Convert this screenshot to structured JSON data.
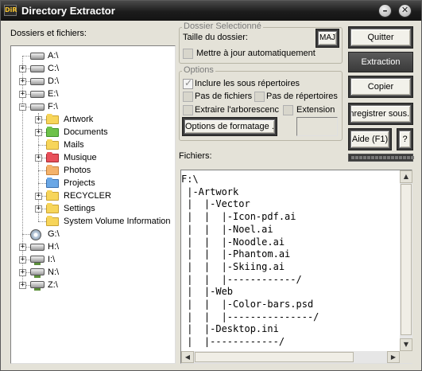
{
  "window": {
    "title": "Directory Extractor",
    "icon_text": "DiR"
  },
  "tree": {
    "label": "Dossiers et fichiers:",
    "items": [
      {
        "label": "A:\\",
        "icon": "floppy-drive-icon",
        "expander": "",
        "level": 0
      },
      {
        "label": "C:\\",
        "icon": "hard-drive-icon",
        "expander": "+",
        "level": 0
      },
      {
        "label": "D:\\",
        "icon": "hard-drive-icon",
        "expander": "+",
        "level": 0
      },
      {
        "label": "E:\\",
        "icon": "hard-drive-icon",
        "expander": "+",
        "level": 0
      },
      {
        "label": "F:\\",
        "icon": "hard-drive-icon",
        "expander": "−",
        "level": 0
      },
      {
        "label": "Artwork",
        "icon": "folder-yellow-icon",
        "expander": "+",
        "level": 1
      },
      {
        "label": "Documents",
        "icon": "folder-green-icon",
        "expander": "+",
        "level": 1
      },
      {
        "label": "Mails",
        "icon": "folder-yellow-icon",
        "expander": "",
        "level": 1
      },
      {
        "label": "Musique",
        "icon": "folder-red-icon",
        "expander": "+",
        "level": 1
      },
      {
        "label": "Photos",
        "icon": "folder-orange-icon",
        "expander": "",
        "level": 1
      },
      {
        "label": "Projects",
        "icon": "folder-blue-icon",
        "expander": "",
        "level": 1
      },
      {
        "label": "RECYCLER",
        "icon": "folder-yellow-icon",
        "expander": "+",
        "level": 1
      },
      {
        "label": "Settings",
        "icon": "folder-yellow-icon",
        "expander": "+",
        "level": 1
      },
      {
        "label": "System Volume Information",
        "icon": "folder-yellow-icon",
        "expander": "",
        "level": 1
      },
      {
        "label": "G:\\",
        "icon": "cd-drive-icon",
        "expander": "",
        "level": 0
      },
      {
        "label": "H:\\",
        "icon": "hard-drive-icon",
        "expander": "+",
        "level": 0
      },
      {
        "label": "I:\\",
        "icon": "network-drive-icon",
        "expander": "+",
        "level": 0
      },
      {
        "label": "N:\\",
        "icon": "network-drive-icon",
        "expander": "+",
        "level": 0
      },
      {
        "label": "Z:\\",
        "icon": "network-drive-icon",
        "expander": "+",
        "level": 0
      }
    ]
  },
  "selected_folder": {
    "group_title": "Dossier Selectionné",
    "size_label": "Taille du dossier:",
    "size_button": "MAJ",
    "auto_update_label": "Mettre à jour automatiquement",
    "auto_update_checked": false
  },
  "options": {
    "group_title": "Options",
    "include_subdirs_label": "Inclure les sous répertoires",
    "include_subdirs_checked": true,
    "no_files_label": "Pas de fichiers",
    "no_dirs_label": "Pas de répertoires",
    "extract_tree_label": "Extraire l'arborescence",
    "extension_label": "Extension",
    "format_button": "Options de formatage ..."
  },
  "buttons": {
    "quit": "Quitter",
    "extract": "Extraction",
    "copy": "Copier",
    "save_as": "Enregistrer sous...",
    "help": "Aide (F1)",
    "question": "?"
  },
  "files": {
    "label": "Fichiers:",
    "content": "F:\\\n |-Artwork\n |  |-Vector\n |  |  |-Icon-pdf.ai\n |  |  |-Noel.ai\n |  |  |-Noodle.ai\n |  |  |-Phantom.ai\n |  |  |-Skiing.ai\n |  |  |------------/\n |  |-Web\n |  |  |-Color-bars.psd\n |  |  |---------------/\n |  |-Desktop.ini\n |  |------------/"
  }
}
